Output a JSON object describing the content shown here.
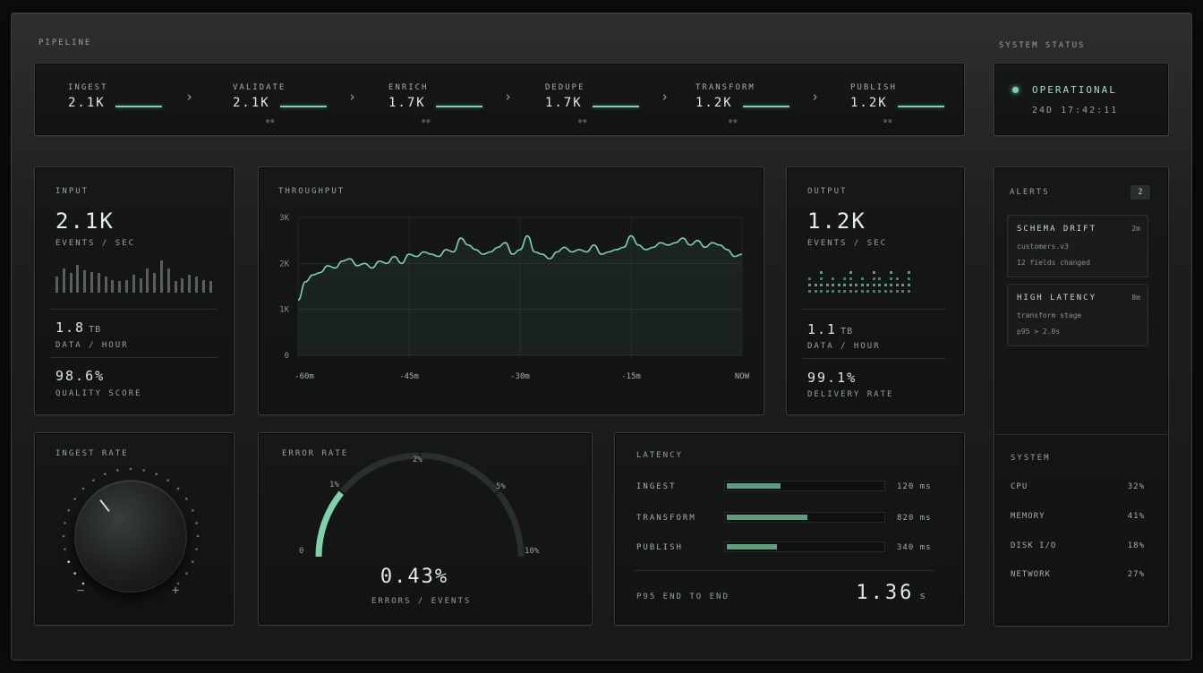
{
  "pipeline": {
    "title": "PIPELINE",
    "stages": [
      {
        "name": "INGEST",
        "value": "2.1K"
      },
      {
        "name": "VALIDATE",
        "value": "2.1K"
      },
      {
        "name": "ENRICH",
        "value": "1.7K"
      },
      {
        "name": "DEDUPE",
        "value": "1.7K"
      },
      {
        "name": "TRANSFORM",
        "value": "1.2K"
      },
      {
        "name": "PUBLISH",
        "value": "1.2K"
      }
    ]
  },
  "system_status": {
    "title": "SYSTEM STATUS",
    "state": "OPERATIONAL",
    "timestamp": "24D 17:42:11",
    "color": "#7fd1ac"
  },
  "input": {
    "title": "INPUT",
    "rate": "2.1K",
    "rate_label": "EVENTS / SEC",
    "data": "1.8",
    "data_unit": "TB",
    "data_label": "DATA / HOUR",
    "quality": "98.6%",
    "quality_label": "QUALITY SCORE",
    "bars": [
      0.5,
      0.75,
      0.6,
      0.85,
      0.7,
      0.65,
      0.6,
      0.5,
      0.4,
      0.35,
      0.4,
      0.55,
      0.45,
      0.75,
      0.6,
      1.0,
      0.75,
      0.35,
      0.45,
      0.55,
      0.5,
      0.4,
      0.35
    ]
  },
  "throughput": {
    "title": "THROUGHPUT"
  },
  "chart_data": {
    "type": "area",
    "title": "THROUGHPUT",
    "x_ticks": [
      "-60m",
      "-45m",
      "-30m",
      "-15m",
      "NOW"
    ],
    "y_ticks": [
      "0",
      "1K",
      "2K",
      "3K"
    ],
    "ylim": [
      0,
      3000
    ],
    "xlim": [
      -60,
      0
    ],
    "x": [
      -60,
      -59,
      -58,
      -57,
      -56,
      -55,
      -54,
      -53,
      -52,
      -51,
      -50,
      -49,
      -48,
      -47,
      -46,
      -45,
      -44,
      -43,
      -42,
      -41,
      -40,
      -39,
      -38,
      -37,
      -36,
      -35,
      -34,
      -33,
      -32,
      -31,
      -30,
      -29,
      -28,
      -27,
      -26,
      -25,
      -24,
      -23,
      -22,
      -21,
      -20,
      -19,
      -18,
      -17,
      -16,
      -15,
      -14,
      -13,
      -12,
      -11,
      -10,
      -9,
      -8,
      -7,
      -6,
      -5,
      -4,
      -3,
      -2,
      -1,
      0
    ],
    "y": [
      1200,
      1600,
      1750,
      1800,
      1950,
      1900,
      2050,
      2100,
      1950,
      2000,
      1900,
      2050,
      2000,
      2150,
      2000,
      2200,
      2150,
      2250,
      2200,
      2150,
      2300,
      2250,
      2550,
      2400,
      2300,
      2200,
      2250,
      2350,
      2450,
      2200,
      2300,
      2600,
      2250,
      2200,
      2100,
      2250,
      2350,
      2250,
      2300,
      2250,
      2400,
      2200,
      2250,
      2300,
      2350,
      2600,
      2400,
      2300,
      2350,
      2450,
      2400,
      2450,
      2550,
      2400,
      2500,
      2350,
      2450,
      2400,
      2300,
      2150,
      2200
    ],
    "grid": true,
    "color": "#7fd1ac"
  },
  "output": {
    "title": "OUTPUT",
    "rate": "1.2K",
    "rate_label": "EVENTS / SEC",
    "data": "1.1",
    "data_unit": "TB",
    "data_label": "DATA / HOUR",
    "delivery": "99.1%",
    "delivery_label": "DELIVERY RATE",
    "dot_columns": [
      3,
      2,
      4,
      2,
      3,
      2,
      3,
      4,
      2,
      3,
      2,
      4,
      3,
      2,
      4,
      3,
      2,
      4
    ]
  },
  "alerts": {
    "title": "ALERTS",
    "count": "2",
    "items": [
      {
        "title": "SCHEMA DRIFT",
        "age": "2m",
        "line1": "customers.v3",
        "line2": "12 fields changed"
      },
      {
        "title": "HIGH LATENCY",
        "age": "8m",
        "line1": "transform stage",
        "line2": "p95  >  2.0s"
      }
    ]
  },
  "system": {
    "title": "SYSTEM",
    "rows": [
      {
        "label": "CPU",
        "value": "32%"
      },
      {
        "label": "MEMORY",
        "value": "41%"
      },
      {
        "label": "DISK I/O",
        "value": "18%"
      },
      {
        "label": "NETWORK",
        "value": "27%"
      }
    ]
  },
  "ingest_rate": {
    "title": "INGEST RATE",
    "minus": "−",
    "plus": "+",
    "level": 0.1
  },
  "error_rate": {
    "title": "ERROR RATE",
    "value": "0.43%",
    "label": "ERRORS / EVENTS",
    "scale": [
      "0",
      "1%",
      "2%",
      "5%",
      "10%"
    ],
    "fill_fraction": 0.22
  },
  "latency": {
    "title": "LATENCY",
    "rows": [
      {
        "name": "INGEST",
        "value": "120 ms",
        "fraction": 0.34
      },
      {
        "name": "TRANSFORM",
        "value": "820 ms",
        "fraction": 0.51
      },
      {
        "name": "PUBLISH",
        "value": "340 ms",
        "fraction": 0.32
      }
    ],
    "p95_label": "P95 END TO END",
    "p95_value": "1.36",
    "p95_unit": "s"
  }
}
